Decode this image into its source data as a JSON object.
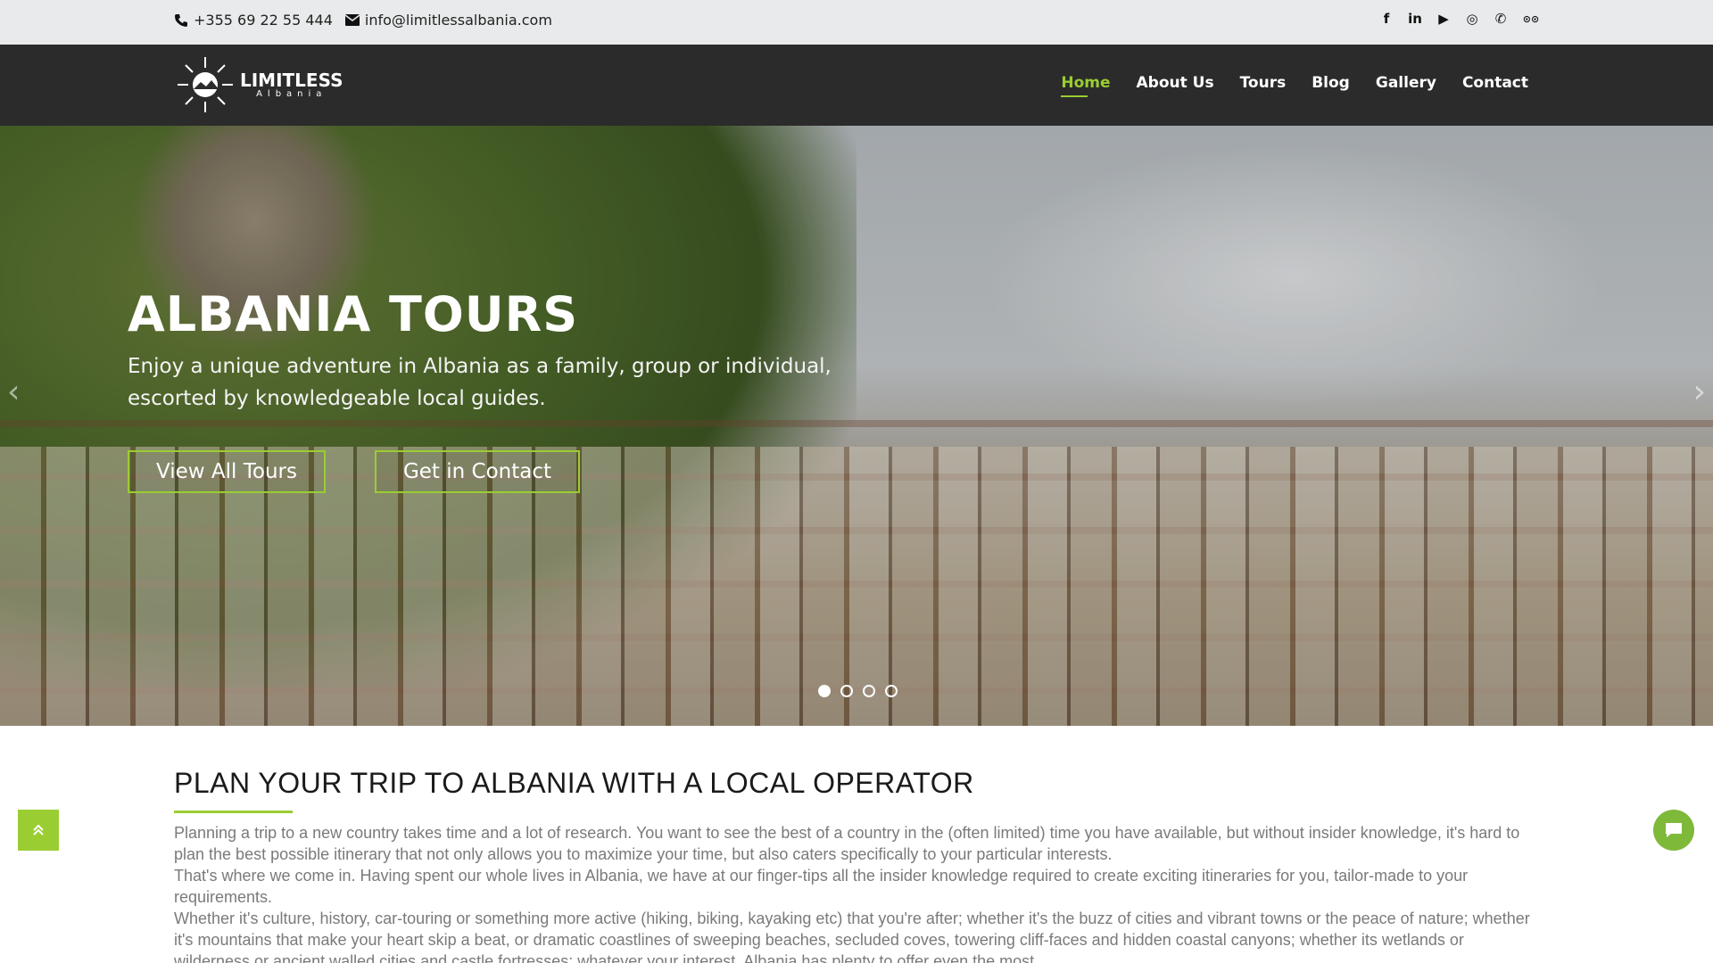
{
  "topbar": {
    "phone": "+355 69 22 55 444",
    "email": "info@limitlessalbania.com",
    "social": [
      {
        "icon": "facebook-icon",
        "glyph": "f"
      },
      {
        "icon": "linkedin-icon",
        "glyph": "in"
      },
      {
        "icon": "youtube-icon",
        "glyph": "▶"
      },
      {
        "icon": "instagram-icon",
        "glyph": "◎"
      },
      {
        "icon": "whatsapp-icon",
        "glyph": "✆"
      },
      {
        "icon": "tripadvisor-icon",
        "glyph": "⊙⊙"
      }
    ]
  },
  "logo": {
    "line1": "LIMITLESS",
    "line2": "Albania"
  },
  "nav": {
    "items": [
      {
        "label": "Home",
        "active": true
      },
      {
        "label": "About Us"
      },
      {
        "label": "Tours"
      },
      {
        "label": "Blog"
      },
      {
        "label": "Gallery"
      },
      {
        "label": "Contact"
      }
    ]
  },
  "hero": {
    "title": "ALBANIA TOURS",
    "lead_line1": "Enjoy a unique adventure in Albania as a family, group or individual,",
    "lead_line2": "escorted by knowledgeable local guides.",
    "button_tours": "View All Tours",
    "button_contact": "Get in Contact",
    "prev_glyph": "‹",
    "next_glyph": "›",
    "slides": 4,
    "active_slide": 1
  },
  "content": {
    "heading": "PLAN YOUR TRIP TO ALBANIA WITH A LOCAL OPERATOR",
    "para1": "Planning a trip to a new country takes time and a lot of research. You want to see the best of a country in the (often limited) time you have available, but without insider knowledge, it's hard to plan the best possible itinerary that not only allows you to maximize your time, but also caters specifically to your particular interests.",
    "para2": "That's where we come in. Having spent our whole lives in Albania, we have at our finger-tips all the insider knowledge required to create exciting itineraries for you, tailor-made to your requirements.",
    "para3": "Whether it's culture, history, car-touring or something more active (hiking, biking, kayaking etc) that you're after; whether it's the buzz of cities and vibrant towns or the peace of nature; whether it's mountains that make your heart skip a beat, or dramatic coastlines of sweeping beaches, secluded coves, towering cliff-faces and hidden coastal canyons; whether its wetlands or wilderness or ancient walled cities and castle fortresses; whatever your interest, Albania has plenty to offer even the most"
  },
  "colors": {
    "accent": "#9acd32",
    "nav_bg": "#2b2b2b",
    "topbar_bg": "#e9eaeb"
  }
}
